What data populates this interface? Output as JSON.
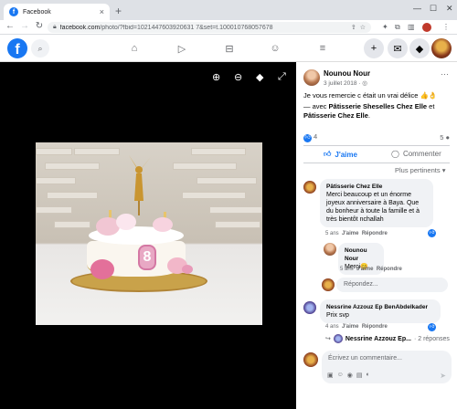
{
  "browser": {
    "tab_title": "Facebook",
    "tab_favicon": "f",
    "url_host": "facebook.com",
    "url_path": "/photo/?fbid=1021447603920631 7&set=t.100010768057678",
    "colors": {
      "tabbar": "#dee1e6",
      "accent": "#1877f2"
    }
  },
  "fb_header": {
    "logo": "f",
    "nav_icons": [
      "home-icon",
      "video-icon",
      "marketplace-icon",
      "groups-icon",
      "menu-icon"
    ],
    "right_icons": [
      "plus-icon",
      "messenger-icon",
      "bell-icon",
      "profile-avatar"
    ]
  },
  "viewer": {
    "tools": [
      "zoom-in-icon",
      "zoom-out-icon",
      "tag-icon",
      "fullscreen-icon"
    ],
    "photo_alt": "Gâteau d'anniversaire fée dorée avec fleurs roses et chiffre 8",
    "cake_number": "8"
  },
  "post": {
    "author": "Nounou Nour",
    "date": "3 juillet 2018 · ",
    "text": "Je vous remercie c était un vrai délice 👍👌",
    "with_prefix": "— avec ",
    "with_tag1": "Pâtisserie Sheselles Chez Elle",
    "with_and": " et ",
    "with_tag2": "Pâtisserie Chez Elle",
    "with_end": ".",
    "reactions_count": "4",
    "comments_count": "5",
    "like_label": "J'aime",
    "comment_label": "Commenter",
    "sort_label": "Plus pertinents ▾"
  },
  "comments": [
    {
      "author": "Pâtisserie Chez Elle",
      "text": "Merci beaucoup et un énorme joyeux anniversaire à Baya. Que du bonheur à toute la famille et à très bientôt nchallah",
      "time": "5 ans",
      "like": "J'aime",
      "reply": "Répondre"
    },
    {
      "author": "Nounou Nour",
      "text": "Merci😊",
      "time": "5 ans",
      "like": "J'aime",
      "reply": "Répondre"
    },
    {
      "author": "Nessrine Azzouz Ep BenAbdelkader",
      "text": "Prix svp",
      "time": "4 ans",
      "like": "J'aime",
      "reply": "Répondre"
    }
  ],
  "reply_placeholder": "Répondez...",
  "replies_summary": {
    "name": "Nessrine Azzouz Ep...",
    "count": "· 2 réponses"
  },
  "compose_placeholder": "Écrivez un commentaire..."
}
